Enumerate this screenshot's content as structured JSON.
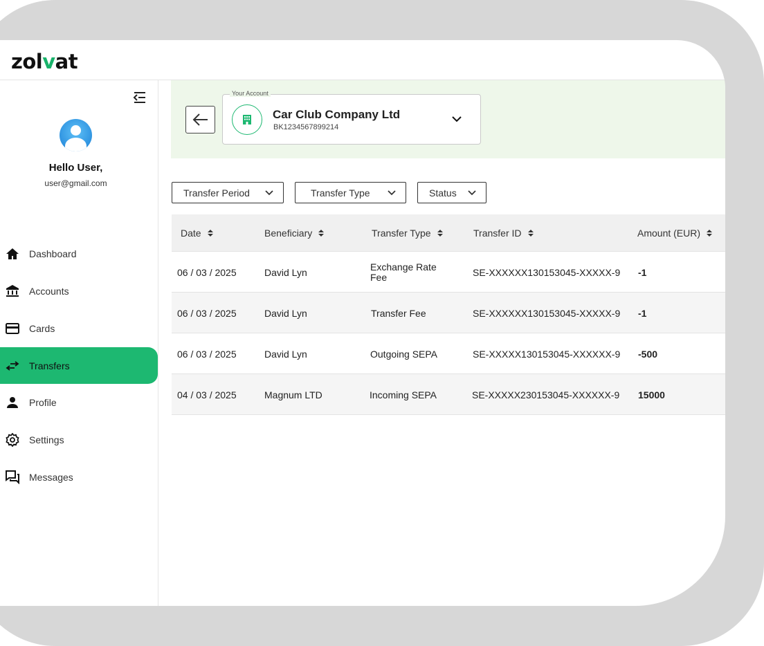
{
  "brand": {
    "logo_prefix": "zol",
    "logo_v": "v",
    "logo_suffix": "at",
    "accent": "#1db871"
  },
  "user": {
    "greeting": "Hello User,",
    "email": "user@gmail.com"
  },
  "sidebar": {
    "items": [
      {
        "label": "Dashboard",
        "icon": "home-icon"
      },
      {
        "label": "Accounts",
        "icon": "bank-icon"
      },
      {
        "label": "Cards",
        "icon": "card-icon"
      },
      {
        "label": "Transfers",
        "icon": "transfer-icon",
        "active": true
      },
      {
        "label": "Profile",
        "icon": "person-icon"
      },
      {
        "label": "Settings",
        "icon": "gear-icon"
      },
      {
        "label": "Messages",
        "icon": "messages-icon"
      }
    ]
  },
  "account": {
    "legend": "Your Account",
    "name": "Car Club Company Ltd",
    "number": "BK1234567899214"
  },
  "filters": {
    "period": "Transfer Period",
    "type": "Transfer Type",
    "status": "Status"
  },
  "table": {
    "headers": [
      "Date",
      "Beneficiary",
      "Transfer Type",
      "Transfer ID",
      "Amount (EUR)"
    ],
    "rows": [
      {
        "date": "06 / 03 /  2025",
        "beneficiary": "David Lyn",
        "type": "Exchange Rate Fee",
        "id": "SE-XXXXXX130153045-XXXXX-9",
        "amount": "-1"
      },
      {
        "date": "06 / 03 /  2025",
        "beneficiary": "David Lyn",
        "type": "Transfer Fee",
        "id": "SE-XXXXXX130153045-XXXXX-9",
        "amount": "-1"
      },
      {
        "date": "06 / 03 /  2025",
        "beneficiary": "David Lyn",
        "type": "Outgoing SEPA",
        "id": "SE-XXXXX130153045-XXXXXX-9",
        "amount": "-500"
      },
      {
        "date": "04 / 03 /  2025",
        "beneficiary": "Magnum LTD",
        "type": "Incoming SEPA",
        "id": "SE-XXXXX230153045-XXXXXX-9",
        "amount": "15000"
      }
    ]
  }
}
